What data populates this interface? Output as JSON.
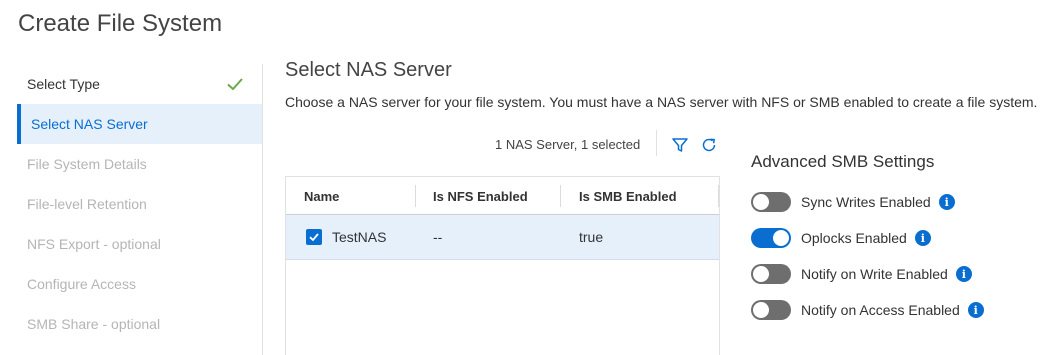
{
  "page": {
    "title": "Create File System"
  },
  "wizard": {
    "steps": [
      {
        "label": "Select Type",
        "state": "done"
      },
      {
        "label": "Select NAS Server",
        "state": "active"
      },
      {
        "label": "File System Details",
        "state": "disabled"
      },
      {
        "label": "File-level Retention",
        "state": "disabled"
      },
      {
        "label": "NFS Export - optional",
        "state": "disabled"
      },
      {
        "label": "Configure Access",
        "state": "disabled"
      },
      {
        "label": "SMB Share - optional",
        "state": "disabled"
      }
    ]
  },
  "section": {
    "title": "Select NAS Server",
    "description": "Choose a NAS server for your file system. You must have a NAS server with NFS or SMB enabled to create a file system."
  },
  "toolbar": {
    "count_text": "1 NAS Server, 1 selected",
    "filter_icon": "filter-icon",
    "refresh_icon": "refresh-icon"
  },
  "table": {
    "columns": [
      "Name",
      "Is NFS Enabled",
      "Is SMB Enabled"
    ],
    "rows": [
      {
        "selected": true,
        "name": "TestNAS",
        "nfs": "--",
        "smb": "true"
      }
    ]
  },
  "advanced": {
    "title": "Advanced SMB Settings",
    "settings": [
      {
        "label": "Sync Writes Enabled",
        "enabled": false
      },
      {
        "label": "Oplocks Enabled",
        "enabled": true
      },
      {
        "label": "Notify on Write Enabled",
        "enabled": false
      },
      {
        "label": "Notify on Access Enabled",
        "enabled": false
      }
    ]
  },
  "colors": {
    "accent": "#0a6ed1",
    "check": "#6aa84f",
    "selected_row": "#e6f0fb"
  }
}
